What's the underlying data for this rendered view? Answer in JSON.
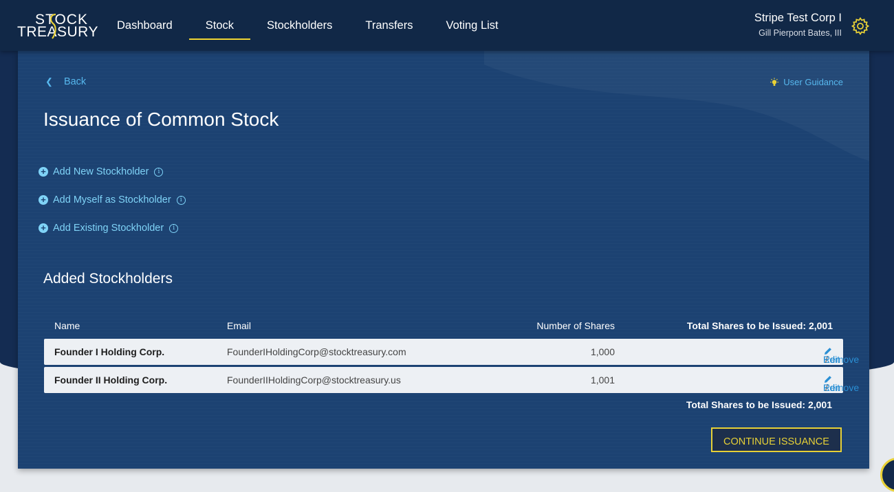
{
  "logo": {
    "line1": "STOCK",
    "line2": "TREASURY"
  },
  "nav": {
    "items": [
      {
        "label": "Dashboard",
        "active": false
      },
      {
        "label": "Stock",
        "active": true
      },
      {
        "label": "Stockholders",
        "active": false
      },
      {
        "label": "Transfers",
        "active": false
      },
      {
        "label": "Voting List",
        "active": false
      }
    ]
  },
  "user": {
    "company": "Stripe Test Corp I",
    "person": "Gill Pierpont Bates, III"
  },
  "page": {
    "back_label": "Back",
    "guidance_label": "User Guidance",
    "title": "Issuance of Common Stock"
  },
  "add_links": [
    {
      "label": "Add New Stockholder"
    },
    {
      "label": "Add Myself as Stockholder"
    },
    {
      "label": "Add Existing Stockholder"
    }
  ],
  "added": {
    "title": "Added Stockholders",
    "columns": {
      "name": "Name",
      "email": "Email",
      "shares": "Number of Shares",
      "total": "Total Shares to be Issued: 2,001"
    },
    "rows": [
      {
        "name": "Founder I Holding Corp.",
        "email": "FounderIHoldingCorp@stocktreasury.com",
        "shares": "1,000",
        "edit": "Edit",
        "sep": "/",
        "remove": "Remove"
      },
      {
        "name": "Founder II Holding Corp.",
        "email": "FounderIIHoldingCorp@stocktreasury.us",
        "shares": "1,001",
        "edit": "Edit",
        "sep": "/",
        "remove": "Remove"
      }
    ],
    "total_bottom": "Total Shares to be Issued: 2,001",
    "continue_label": "CONTINUE ISSUANCE"
  },
  "colors": {
    "accent": "#e8d136",
    "link": "#57b8ee",
    "panel": "#1c4272",
    "topbar": "#112847"
  }
}
